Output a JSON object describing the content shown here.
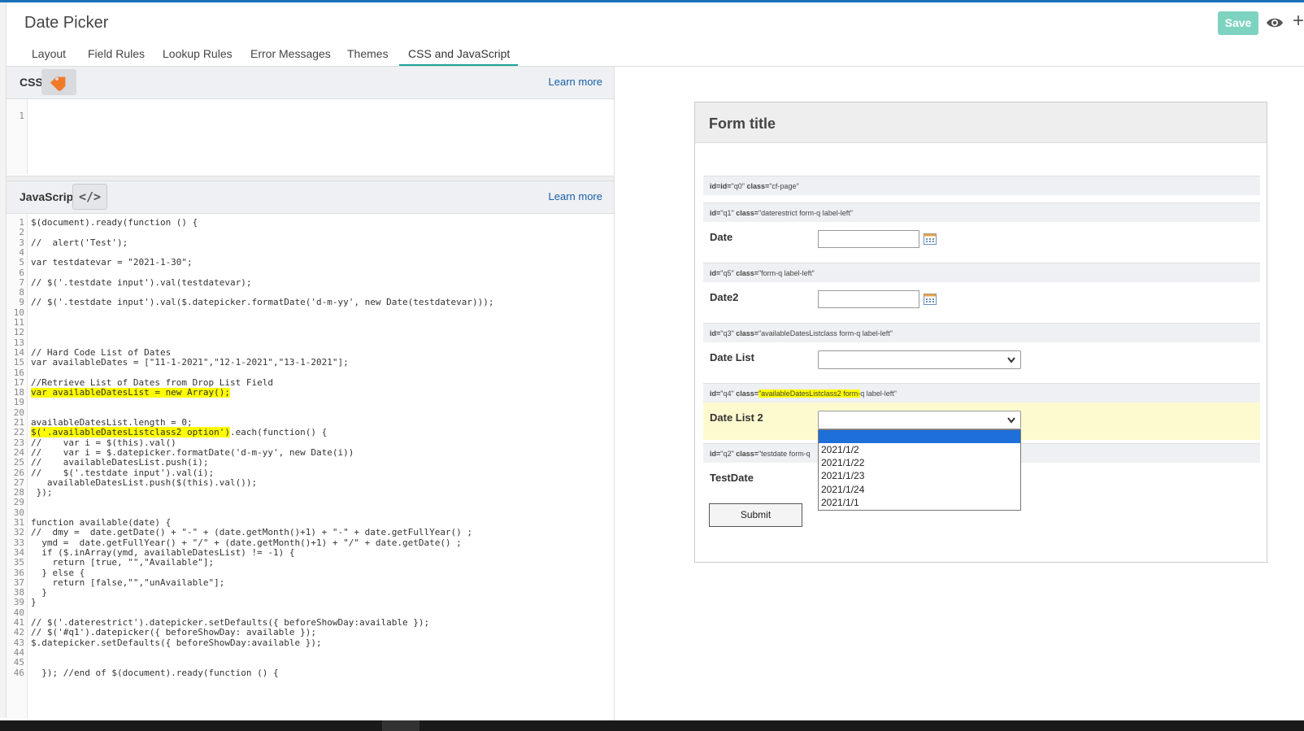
{
  "app": {
    "title": "Date Picker",
    "save_label": "Save"
  },
  "tabs": [
    {
      "label": "Layout"
    },
    {
      "label": "Field Rules"
    },
    {
      "label": "Lookup Rules"
    },
    {
      "label": "Error Messages"
    },
    {
      "label": "Themes"
    },
    {
      "label": "CSS and JavaScript",
      "active": true
    }
  ],
  "css_panel": {
    "label": "CSS",
    "learn_more": "Learn more",
    "line_numbers": [
      "1"
    ]
  },
  "js_panel": {
    "label": "JavaScript",
    "learn_more": "Learn more",
    "lines": [
      "$(document).ready(function () {",
      "",
      "//  alert('Test');",
      "",
      "var testdatevar = \"2021-1-30\";",
      "",
      "// $('.testdate input').val(testdatevar);",
      "",
      "// $('.testdate input').val($.datepicker.formatDate('d-m-yy', new Date(testdatevar)));",
      "",
      "",
      "",
      "",
      "// Hard Code List of Dates",
      "var availableDates = [\"11-1-2021\",\"12-1-2021\",\"13-1-2021\"];",
      "",
      "//Retrieve List of Dates from Drop List Field",
      "var availableDatesList = new Array();",
      "",
      "",
      "availableDatesList.length = 0;",
      "$('.availableDatesListclass2 option').each(function() {",
      "//    var i = $(this).val()",
      "//    var i = $.datepicker.formatDate('d-m-yy', new Date(i))",
      "//    availableDatesList.push(i);",
      "//    $('.testdate input').val(i);",
      "   availableDatesList.push($(this).val());",
      " });",
      "",
      "",
      "function available(date) {",
      "//  dmy =  date.getDate() + \"-\" + (date.getMonth()+1) + \"-\" + date.getFullYear() ;",
      "  ymd =  date.getFullYear() + \"/\" + (date.getMonth()+1) + \"/\" + date.getDate() ;",
      "  if ($.inArray(ymd, availableDatesList) != -1) {",
      "    return [true, \"\",\"Available\"];",
      "  } else {",
      "    return [false,\"\",\"unAvailable\"];",
      "  }",
      "}",
      "",
      "// $('.daterestrict').datepicker.setDefaults({ beforeShowDay:available });",
      "// $('#q1').datepicker({ beforeShowDay: available });",
      "$.datepicker.setDefaults({ beforeShowDay:available });",
      "",
      "",
      "  }); //end of $(document).ready(function () {"
    ]
  },
  "form": {
    "title": "Form title",
    "id_bars": [
      {
        "id": "id=\"q0\"",
        "cls": "class=\"cf-page\""
      },
      {
        "id": "id=\"q1\"",
        "cls": "class=\"daterestrict form-q label-left\""
      },
      {
        "id": "id=\"q5\"",
        "cls": "class=\"form-q label-left\""
      },
      {
        "id": "id=\"q3\"",
        "cls": "class=\"availableDatesListclass form-q label-left\""
      },
      {
        "id": "id=\"q4\"",
        "cls_hl": "\"availableDatesListclass2 form-",
        "cls_rest": "q label-left\""
      },
      {
        "id": "id=\"q2\"",
        "cls": "class=\"testdate form-q"
      }
    ],
    "q4_class_prefix": "class=",
    "fields": {
      "date": "Date",
      "date2": "Date2",
      "date_list": "Date List",
      "date_list2": "Date List 2",
      "testdate": "TestDate"
    },
    "submit_label": "Submit",
    "dropdown_options": [
      "2021/1/2",
      "2021/1/22",
      "2021/1/23",
      "2021/1/24",
      "2021/1/1"
    ]
  },
  "colors": {
    "accent": "#1aa39a",
    "save": "#7dd3c0",
    "highlight": "#fdfd00",
    "link": "#1a5fa8"
  }
}
